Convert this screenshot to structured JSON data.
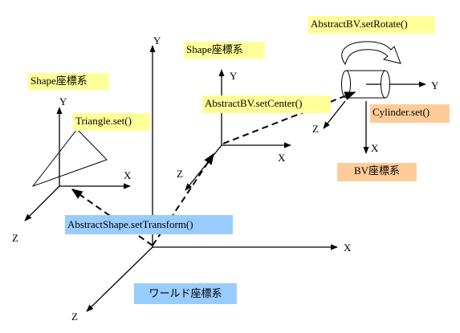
{
  "diagram": {
    "axes": {
      "x": "X",
      "y": "Y",
      "z": "Z"
    },
    "labels": {
      "shape_frame_left": "Shape座標系",
      "shape_frame_mid": "Shape座標系",
      "triangle_set": "Triangle.set()",
      "abstractbv_setcenter": "AbstractBV.setCenter()",
      "abstractbv_setrotate": "AbstractBV.setRotate()",
      "cylinder_set": "Cylinder.set()",
      "bv_frame": "BV座標系",
      "abstractshape_settransform": "AbstractShape.setTransform()",
      "world_frame": "ワールド座標系"
    },
    "colors": {
      "yellow": "#ffff99",
      "orange": "#ffcc99",
      "blue": "#99ccff",
      "line": "#000000"
    }
  }
}
